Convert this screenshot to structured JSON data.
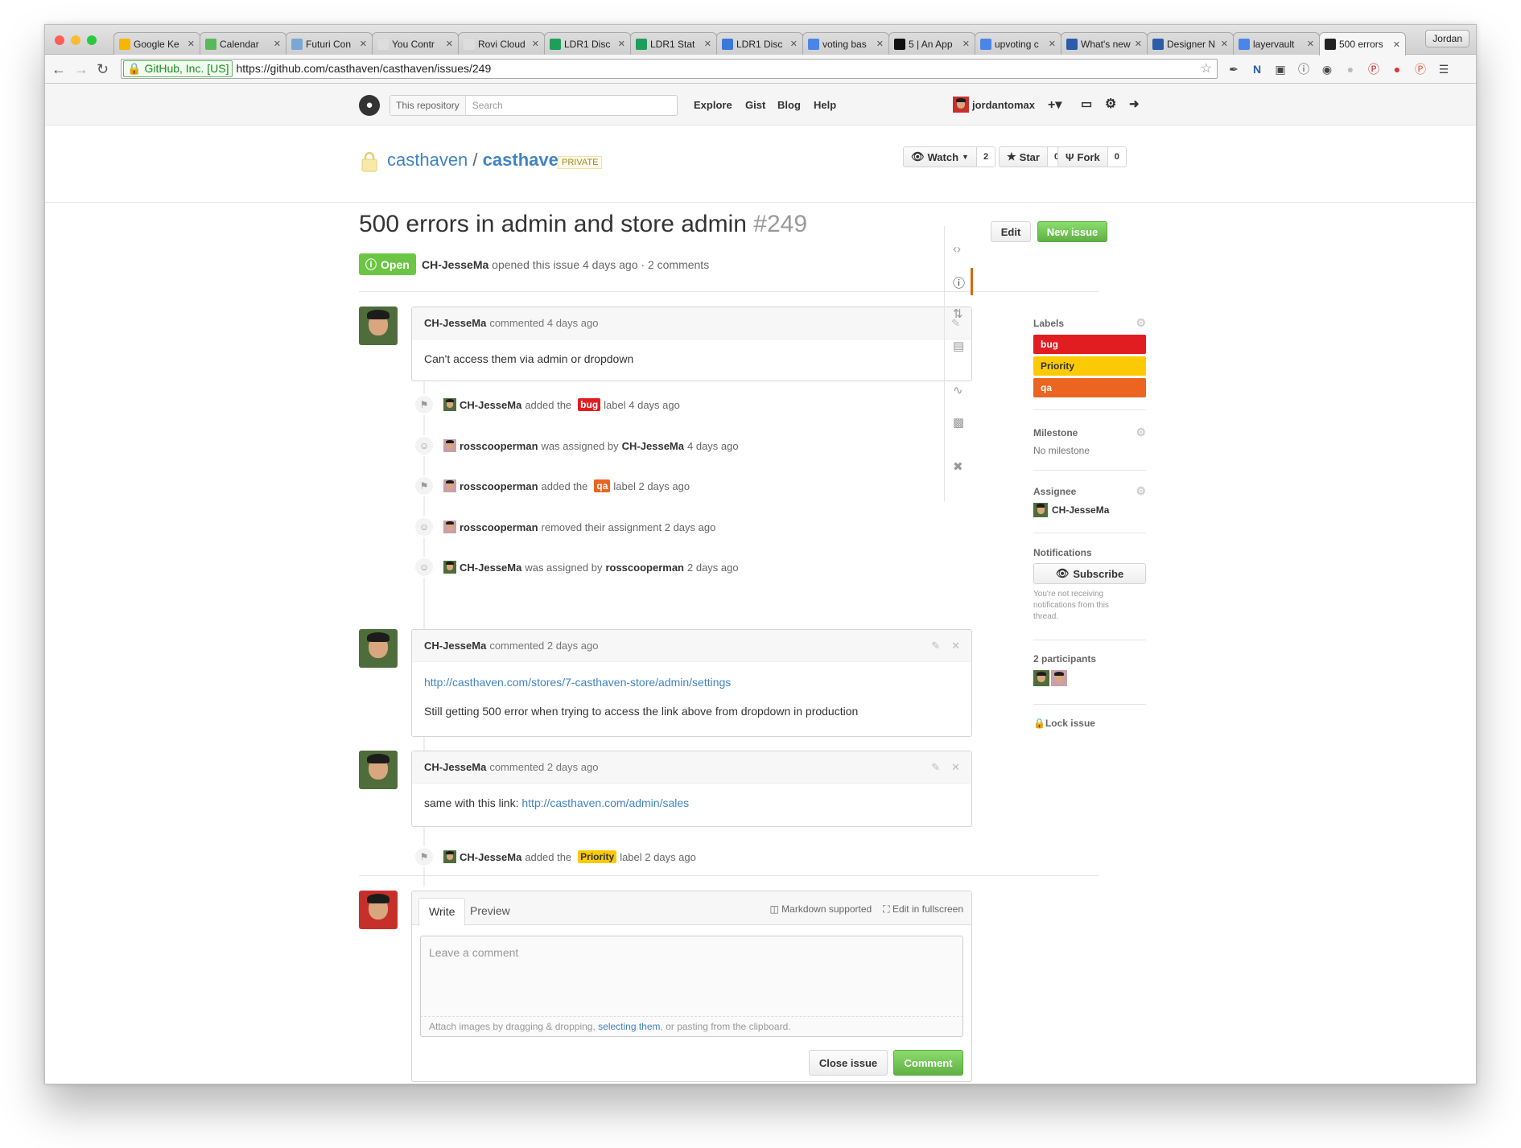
{
  "browser": {
    "tabs": [
      {
        "title": "Google Ke",
        "fav_color": "#f7b600"
      },
      {
        "title": "Calendar",
        "fav_color": "#58b95a"
      },
      {
        "title": "Futuri Con",
        "fav_color": "#7aa7d6"
      },
      {
        "title": "You Contr",
        "fav_color": "#dddddd"
      },
      {
        "title": "Rovi Cloud",
        "fav_color": "#dddddd"
      },
      {
        "title": "LDR1 Disc",
        "fav_color": "#1e9e5b"
      },
      {
        "title": "LDR1 Stat",
        "fav_color": "#1e9e5b"
      },
      {
        "title": "LDR1 Disc",
        "fav_color": "#3c78d8"
      },
      {
        "title": "voting bas",
        "fav_color": "#4a86e8"
      },
      {
        "title": "5 | An App",
        "fav_color": "#111111"
      },
      {
        "title": "upvoting c",
        "fav_color": "#4a86e8"
      },
      {
        "title": "What's new",
        "fav_color": "#2a5caa"
      },
      {
        "title": "Designer N",
        "fav_color": "#2a5caa"
      },
      {
        "title": "layervault",
        "fav_color": "#4a86e8"
      },
      {
        "title": "500 errors",
        "fav_color": "#222222"
      }
    ],
    "profile": "Jordan",
    "ev_label": "GitHub, Inc. [US]",
    "url": "https://github.com/casthaven/casthaven/issues/249"
  },
  "header": {
    "scope": "This repository",
    "search_placeholder": "Search",
    "nav": [
      "Explore",
      "Gist",
      "Blog",
      "Help"
    ],
    "user": "jordantomax"
  },
  "repo": {
    "owner": "casthaven",
    "slash": "/",
    "name": "casthaven",
    "visibility": "PRIVATE",
    "watch": {
      "label": "Watch",
      "count": "2"
    },
    "star": {
      "label": "Star",
      "count": "0"
    },
    "fork": {
      "label": "Fork",
      "count": "0"
    }
  },
  "issue": {
    "title": "500 errors in admin and store admin",
    "number": "#249",
    "edit": "Edit",
    "new_issue": "New issue",
    "state": "Open",
    "author": "CH-JesseMa",
    "meta": "opened this issue 4 days ago · 2 comments"
  },
  "comments": [
    {
      "author": "CH-JesseMa",
      "when": "commented 4 days ago",
      "body": "Can't access them via admin or dropdown"
    },
    {
      "author": "CH-JesseMa",
      "when": "commented 2 days ago",
      "link": "http://casthaven.com/stores/7-casthaven-store/admin/settings",
      "body": "Still getting 500 error when trying to access the link above from dropdown in production"
    },
    {
      "author": "CH-JesseMa",
      "when": "commented 2 days ago",
      "prefix": "same with this link: ",
      "link": "http://casthaven.com/admin/sales"
    }
  ],
  "events": [
    {
      "user": "CH-JesseMa",
      "pre": "added the",
      "label": "bug",
      "label_color": "#e11d21",
      "post": "label 4 days ago"
    },
    {
      "user": "rosscooperman",
      "pre": "was assigned by",
      "target": "CH-JesseMa",
      "post": "4 days ago"
    },
    {
      "user": "rosscooperman",
      "pre": "added the",
      "label": "qa",
      "label_color": "#eb6420",
      "post": "label 2 days ago"
    },
    {
      "user": "rosscooperman",
      "pre": "removed their assignment 2 days ago"
    },
    {
      "user": "CH-JesseMa",
      "pre": "was assigned by",
      "target": "rosscooperman",
      "post": "2 days ago"
    },
    {
      "user": "CH-JesseMa",
      "pre": "added the",
      "label": "Priority",
      "label_color": "#fbca04",
      "post": "label 2 days ago"
    }
  ],
  "sidebar": {
    "labels_title": "Labels",
    "labels": [
      {
        "name": "bug",
        "color": "#e11d21"
      },
      {
        "name": "Priority",
        "color": "#fbca04"
      },
      {
        "name": "qa",
        "color": "#eb6420"
      }
    ],
    "milestone_title": "Milestone",
    "milestone_value": "No milestone",
    "assignee_title": "Assignee",
    "assignee": "CH-JesseMa",
    "notifications_title": "Notifications",
    "subscribe": "Subscribe",
    "notif_text": "You're not receiving notifications from this thread.",
    "participants_title": "2 participants",
    "lock": "Lock issue"
  },
  "editor": {
    "write": "Write",
    "preview": "Preview",
    "markdown": "Markdown supported",
    "fullscreen": "Edit in fullscreen",
    "placeholder": "Leave a comment",
    "attach_pre": "Attach images by dragging & dropping, ",
    "attach_link": "selecting them",
    "attach_post": ", or pasting from the clipboard.",
    "close": "Close issue",
    "comment": "Comment"
  }
}
